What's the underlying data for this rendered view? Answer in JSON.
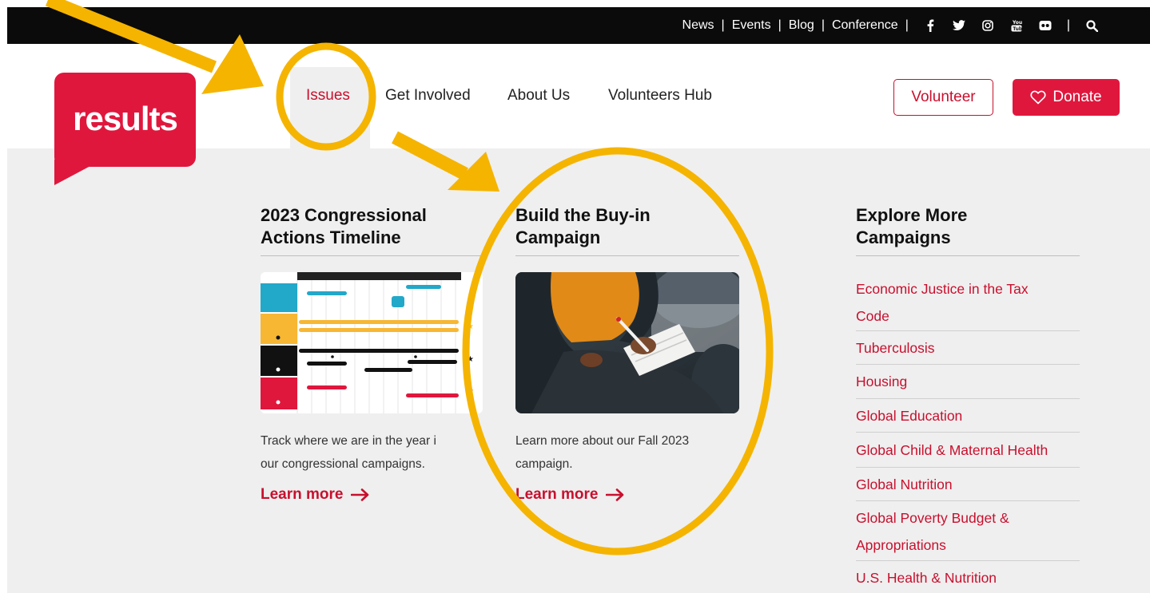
{
  "topnav": {
    "links": [
      "News",
      "Events",
      "Blog",
      "Conference"
    ],
    "social_icons": [
      "facebook-icon",
      "twitter-icon",
      "instagram-icon",
      "youtube-icon",
      "flickr-icon"
    ],
    "search_icon": "search-icon"
  },
  "logo": {
    "text": "results"
  },
  "mainnav": {
    "items": [
      "Issues",
      "Get Involved",
      "About Us",
      "Volunteers Hub"
    ],
    "active": "Issues"
  },
  "buttons": {
    "volunteer": "Volunteer",
    "donate": "Donate"
  },
  "columns": {
    "timeline": {
      "title_line1": "2023 Congressional",
      "title_line2": "Actions Timeline",
      "desc_line1": "Track where we are in the year i",
      "desc_line2": "our congressional campaigns.",
      "learn": "Learn more"
    },
    "buyin": {
      "title_line1": "Build the Buy-in",
      "title_line2": "Campaign",
      "desc_line1": "Learn more about our Fall 2023",
      "desc_line2": "campaign.",
      "learn": "Learn more"
    },
    "explore": {
      "title_line1": "Explore More",
      "title_line2": "Campaigns",
      "links": [
        "Economic Justice in the Tax",
        "Code",
        "Tuberculosis",
        "Housing",
        "Global Education",
        "Global Child & Maternal Health",
        "Global Nutrition",
        "Global Poverty Budget &",
        "Appropriations",
        "U.S. Health & Nutrition"
      ]
    }
  },
  "colors": {
    "brand_red": "#e0173d",
    "link_red": "#c8102e",
    "annotation_yellow": "#f5b400",
    "panel_gray": "#efefef"
  }
}
